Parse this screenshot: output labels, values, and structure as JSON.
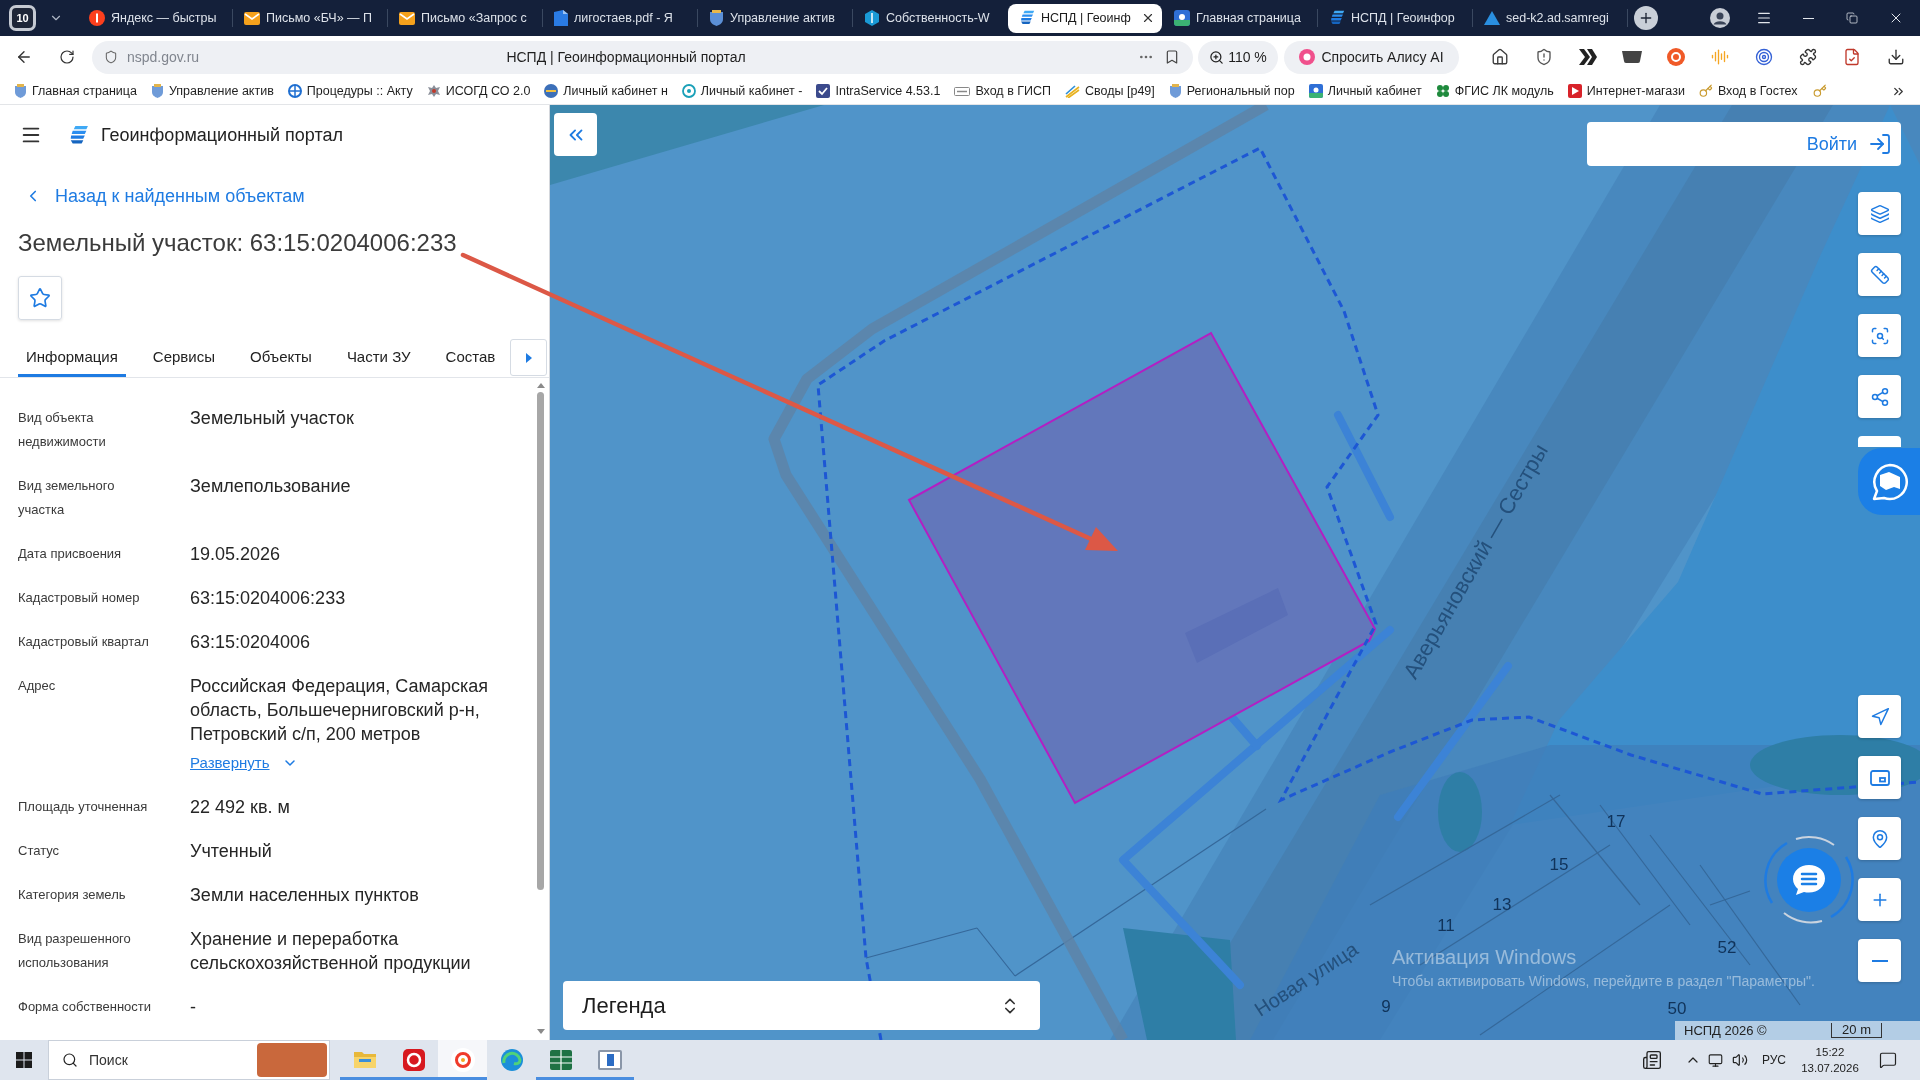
{
  "browser": {
    "tab_counter": "10",
    "tabs": [
      {
        "title": "Яндекс — быстры",
        "kind": "yandex",
        "selected": false
      },
      {
        "title": "Письмо «БЧ» — П",
        "kind": "mail",
        "selected": false
      },
      {
        "title": "Письмо «Запрос с",
        "kind": "mail",
        "selected": false
      },
      {
        "title": "лигостаев.pdf - Я",
        "kind": "pdf",
        "selected": false
      },
      {
        "title": "Управление актив",
        "kind": "crest",
        "selected": false
      },
      {
        "title": "Собственность-W",
        "kind": "cube",
        "selected": false
      },
      {
        "title": "НСПД | Геоинф",
        "kind": "nspd",
        "selected": true
      },
      {
        "title": "Главная страница",
        "kind": "gosuslugi",
        "selected": false
      },
      {
        "title": "НСПД | Геоинфор",
        "kind": "nspd",
        "selected": false
      },
      {
        "title": "sed-k2.ad.samregi",
        "kind": "sed",
        "selected": false
      }
    ],
    "address_bar": {
      "url": "nspd.gov.ru",
      "page_title": "НСПД | Геоинформационный портал",
      "zoom": "110 %",
      "assistant": "Спросить Алису AI"
    },
    "bookmarks": [
      "Главная страница",
      "Управление актив",
      "Процедуры :: Акту",
      "ИСОГД СО 2.0",
      "Личный кабинет н",
      "Личный кабинет -",
      "IntraService 4.53.1",
      "Вход в ГИСП",
      "Своды [р49]",
      "Региональный пор",
      "Личный кабинет",
      "ФГИС ЛК модуль",
      "Интернет-магази",
      "Вход в Гостех"
    ]
  },
  "header": {
    "title": "Геоинформационный портал"
  },
  "back_link": "Назад к найденным объектам",
  "object_title": "Земельный участок: 63:15:0204006:233",
  "favorite": {
    "on": false
  },
  "tabs": [
    {
      "label": "Информация",
      "selected": true
    },
    {
      "label": "Сервисы",
      "selected": false
    },
    {
      "label": "Объекты",
      "selected": false
    },
    {
      "label": "Части ЗУ",
      "selected": false
    },
    {
      "label": "Состав",
      "selected": false
    }
  ],
  "properties": [
    {
      "label": "Вид объекта недвижимости",
      "value": "Земельный участок"
    },
    {
      "label": "Вид земельного участка",
      "value": "Землепользование"
    },
    {
      "label": "Дата присвоения",
      "value": "19.05.2026"
    },
    {
      "label": "Кадастровый номер",
      "value": "63:15:0204006:233"
    },
    {
      "label": "Кадастровый квартал",
      "value": "63:15:0204006"
    },
    {
      "label": "Адрес",
      "value": "Российская Федерация, Самарская область, Большечерниговский р-н, Петровский с/п, 200 метров",
      "link": "Развернуть"
    },
    {
      "label": "Площадь уточненная",
      "value": "22 492 кв. м"
    },
    {
      "label": "Статус",
      "value": "Учтенный"
    },
    {
      "label": "Категория земель",
      "value": "Земли населенных пунктов"
    },
    {
      "label": "Вид разрешенного использования",
      "value": "Хранение и переработка сельскохозяйственной продукции"
    },
    {
      "label": "Форма собственности",
      "value": "-"
    }
  ],
  "map": {
    "login": "Войти",
    "legend": "Легенда",
    "attribution": "НСПД 2026 ©",
    "scale": "20 m",
    "labels": [
      {
        "text": "Аверьяновский — Сестры",
        "kind": "street"
      },
      {
        "text": "Новая улица",
        "kind": "street"
      },
      {
        "text": "17",
        "kind": "house"
      },
      {
        "text": "15",
        "kind": "house"
      },
      {
        "text": "13",
        "kind": "house"
      },
      {
        "text": "11",
        "kind": "house"
      },
      {
        "text": "9",
        "kind": "house"
      },
      {
        "text": "52",
        "kind": "house"
      },
      {
        "text": "50",
        "kind": "house"
      }
    ]
  },
  "os_notice": {
    "title": "Активация Windows",
    "text": "Чтобы активировать Windows, перейдите в раздел \"Параметры\"."
  },
  "taskbar": {
    "search_placeholder": "Поиск",
    "apps": [
      {
        "kind": "explorer",
        "running": true,
        "selected": false
      },
      {
        "kind": "app",
        "running": true,
        "selected": false
      },
      {
        "kind": "browser",
        "running": true,
        "selected": true
      },
      {
        "kind": "edge",
        "running": false,
        "selected": false
      },
      {
        "kind": "spreadsheet",
        "running": true,
        "selected": false
      },
      {
        "kind": "window",
        "running": true,
        "selected": false
      }
    ],
    "language": "РУС",
    "time": "15:22",
    "date": "13.07.2026"
  }
}
